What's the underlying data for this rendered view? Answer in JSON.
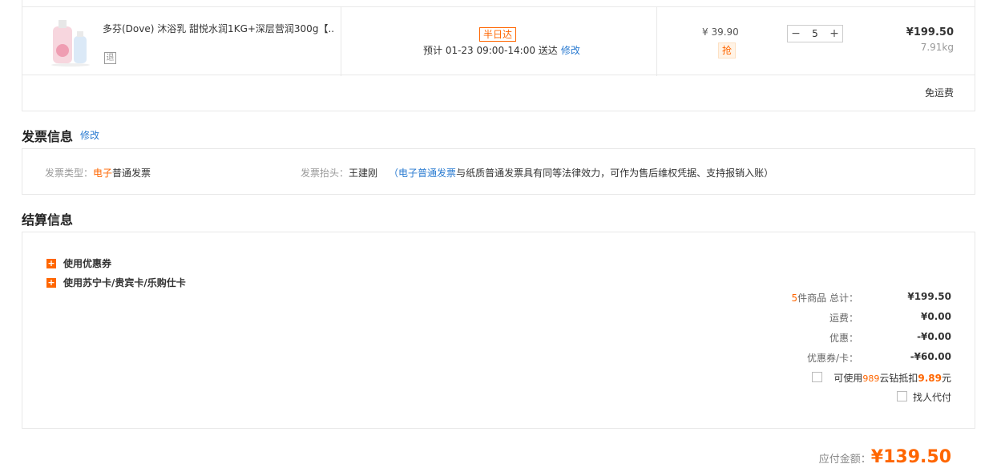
{
  "product": {
    "name": "多芬(Dove) 沐浴乳 甜悦水润1KG+深层营润300g【...",
    "return_badge": "退",
    "delivery_badge": "半日达",
    "delivery_text": "预计 01-23 09:00-14:00  送达",
    "delivery_modify": "修改",
    "unit_price": "¥ 39.90",
    "grab_badge": "抢",
    "qty_minus": "−",
    "qty_value": "5",
    "qty_plus": "+",
    "subtotal": "¥199.50",
    "weight": "7.91kg",
    "free_shipping": "免运费"
  },
  "invoice": {
    "title": "发票信息",
    "modify": "修改",
    "type_label": "发票类型：",
    "type_value_highlight": "电子",
    "type_value_rest": "普通发票",
    "head_label": "发票抬头：",
    "head_value": "王建刚",
    "note_open": "（",
    "note_link": "电子普通发票",
    "note_rest": "与纸质普通发票具有同等法律效力，可作为售后维权凭据、支持报销入账）"
  },
  "settlement": {
    "title": "结算信息",
    "coupon_option": "使用优惠券",
    "card_option": "使用苏宁卡/贵宾卡/乐购仕卡",
    "item_count": "5",
    "item_count_suffix": "件商品  总计：",
    "total": "¥199.50",
    "shipping_label": "运费：",
    "shipping": "¥0.00",
    "discount_label": "优惠：",
    "discount": "-¥0.00",
    "coupon_label": "优惠券/卡：",
    "coupon": "-¥60.00",
    "diamond_prefix": "可使用",
    "diamond_count": "989",
    "diamond_mid": "云钻抵扣",
    "diamond_amount": "9.89",
    "diamond_suffix": "元",
    "proxy_pay": "找人代付"
  },
  "payable": {
    "label": "应付金额：",
    "amount": "¥139.50"
  },
  "colors": {
    "accent": "#ff6600",
    "link": "#2a7bd1",
    "border": "#e8e8e8"
  }
}
